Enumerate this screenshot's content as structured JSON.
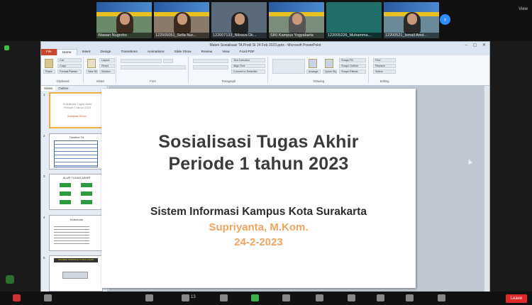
{
  "zoom": {
    "view_label": "View",
    "participants": [
      {
        "name": "Wawan Nugroho"
      },
      {
        "name": "122005051_Sella Nur..."
      },
      {
        "name": "122007133_Nilzava Dk..."
      },
      {
        "name": "SIKI Kampus Yogyakarta"
      },
      {
        "name": "122005226_Muhamma..."
      },
      {
        "name": "12200521_Ismail Amd..."
      }
    ],
    "participant_count": "13",
    "leave_label": "Leave"
  },
  "ppt": {
    "window_title": "Materi Sosialisasi TA Prodi SI 24 Feb 2023.pptx - Microsoft PowerPoint",
    "window_controls": "– ▢ ✕",
    "tabs": [
      "File",
      "Home",
      "Insert",
      "Design",
      "Transitions",
      "Animations",
      "Slide Show",
      "Review",
      "View",
      "Foxit PDF"
    ],
    "ribbon": {
      "clipboard": {
        "label": "Clipboard",
        "paste": "Paste",
        "cut": "Cut",
        "copy": "Copy",
        "format_painter": "Format Painter"
      },
      "slides": {
        "label": "Slides",
        "new_slide": "New Slide",
        "layout": "Layout",
        "reset": "Reset",
        "section": "Section"
      },
      "font": {
        "label": "Font"
      },
      "paragraph": {
        "label": "Paragraph",
        "text_direction": "Text Direction",
        "align_text": "Align Text",
        "convert": "Convert to SmartArt"
      },
      "drawing": {
        "label": "Drawing",
        "arrange": "Arrange",
        "quick_styles": "Quick Styles",
        "shape_fill": "Shape Fill",
        "shape_outline": "Shape Outline",
        "shape_effects": "Shape Effects"
      },
      "editing": {
        "label": "Editing",
        "find": "Find",
        "replace": "Replace",
        "select": "Select"
      }
    },
    "side_tabs": [
      "Slides",
      "Outline"
    ],
    "thumbnails": [
      {
        "num": "1",
        "title": "Sosialisasi Tugas Akhir Periode 1 tahun 2023",
        "sub": "Supriyanta, M.Kom."
      },
      {
        "num": "2",
        "title": "Timeline TA"
      },
      {
        "num": "3",
        "title": "ALUR TUGAS AKHIR"
      },
      {
        "num": "4",
        "title": "Ketentuan"
      },
      {
        "num": "5",
        "title": "SUMBER PEDOMAN TUGAS AKHIR"
      }
    ],
    "slide": {
      "title_line1": "Sosialisasi Tugas Akhir",
      "title_line2": "Periode 1 tahun 2023",
      "subtitle": "Sistem Informasi Kampus Kota Surakarta",
      "presenter": "Supriyanta, M.Kom.",
      "date": "24-2-2023"
    }
  },
  "colors": {
    "accent_orange": "#f2a560",
    "ppt_file_tab": "#c9462c",
    "zoom_leave": "#e02828",
    "zoom_blue": "#2d8cff"
  }
}
